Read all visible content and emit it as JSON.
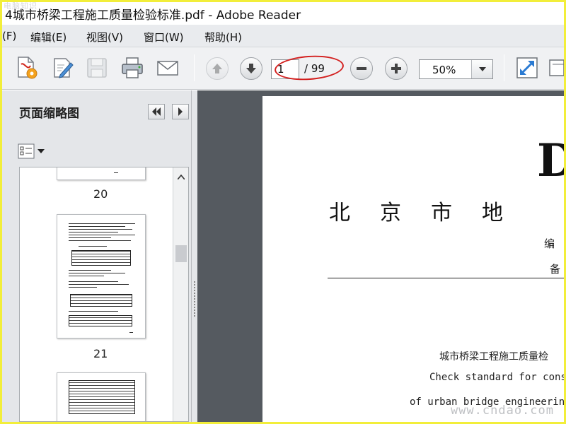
{
  "window": {
    "title": "4城市桥梁工程施工质量检验标准.pdf - Adobe Reader",
    "corner_watermark": "电脑知识"
  },
  "menu": {
    "items": [
      "(F)",
      "编辑(E)",
      "视图(V)",
      "窗口(W)",
      "帮助(H)"
    ]
  },
  "toolbar": {
    "icons": [
      "create-pdf-icon",
      "edit-icon",
      "save-icon",
      "print-icon",
      "email-icon",
      "page-up-icon",
      "page-down-icon",
      "zoom-out-icon",
      "zoom-in-icon",
      "fit-icon"
    ],
    "page_current": "1",
    "page_total": "/ 99",
    "zoom": "50%"
  },
  "left_pane": {
    "title": "页面缩略图",
    "thumbnails": [
      {
        "label": "20"
      },
      {
        "label": "21"
      },
      {
        "label": ""
      }
    ]
  },
  "document": {
    "big_letter": "D",
    "heading": "北京市地",
    "line1": "编",
    "line2": "备",
    "cn_title": "城市桥梁工程施工质量检",
    "en_line1": "Check standard for const",
    "en_line2": "of urban bridge engineering"
  },
  "site_watermark": "www.cndao.com",
  "colors": {
    "frame": "#f2ee3a",
    "annotation": "#d3201f",
    "doc_background": "#555a60"
  }
}
